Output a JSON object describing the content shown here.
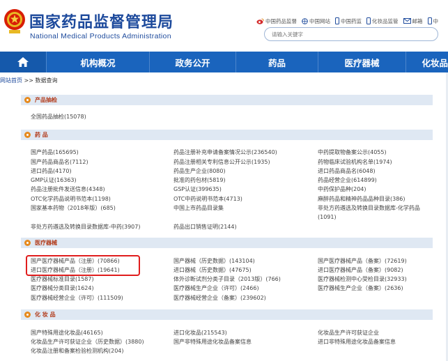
{
  "header": {
    "title_cn": "国家药品监督管理局",
    "title_en": "National Medical Products Administration",
    "toplinks": [
      {
        "label": "中国药品监督",
        "icon": "weibo-icon"
      },
      {
        "label": "中国网站",
        "icon": "globe-icon"
      },
      {
        "label": "中国药监",
        "icon": "mobile-icon"
      },
      {
        "label": "化妆品监管",
        "icon": "mobile-icon"
      },
      {
        "label": "邮箱",
        "icon": "mail-icon"
      },
      {
        "label": "中",
        "icon": "mobile-icon"
      }
    ],
    "search_placeholder": "请输入关键字"
  },
  "nav": {
    "items": [
      "机构概况",
      "政务公开",
      "药品",
      "医疗器械",
      "化妆品"
    ]
  },
  "breadcrumb": {
    "home": "网站首页",
    "sep": " >> ",
    "current": "数据查询"
  },
  "sections": [
    {
      "title": "产品抽检",
      "links": [
        "全国药品抽检(15078)"
      ]
    },
    {
      "title": "药 品",
      "col1": [
        "国产药品(165695)",
        "国产药品商品名(7112)",
        "进口药品(4170)",
        "GMP认证(16363)",
        "药品注册批件发送信息(4348)",
        "OTC化学药品说明书范本(1198)",
        "国家基本药物（2018年版）(685)",
        "",
        "非处方药遴选及转换目录数据库-中药(3907)"
      ],
      "col2": [
        "药品注册补充申请备案情况公示(236540)",
        "药品注册相关专利信息公开公示(1935)",
        "药品生产企业(8080)",
        "批准的药包材(5819)",
        "GSP认证(399635)",
        "OTC中药说明书范本(4713)",
        "中国上市药品目录集",
        "",
        "药品出口销售证明(2144)"
      ],
      "col3": [
        "中药提取物备案公示(4055)",
        "药物临床试验机构名单(1974)",
        "进口药品商品名(6048)",
        "药品经营企业(614899)",
        "中药保护品种(204)",
        "麻醉药品和精神药品品种目录(386)",
        "非处方药遴选及转换目录数据库-化学药品",
        "(1091)"
      ]
    },
    {
      "title": "医疗器械",
      "col1": [
        "国产医疗器械产品（注册）(70866)",
        "进口医疗器械产品（注册）(19641)",
        "医疗器械标准目录(1587)",
        "医疗器械分类目录(1624)",
        "医疗器械经营企业（许可）(111509)"
      ],
      "col2": [
        "国产器械（历史数据）(143104)",
        "进口器械（历史数据）(47675)",
        "体外诊断试剂分类子目录（2013版）(766)",
        "医疗器械生产企业（许可）(2466)",
        "医疗器械经营企业（备案）(239602)"
      ],
      "col3": [
        "国产医疗器械产品（备案）(72619)",
        "进口医疗器械产品（备案）(9082)",
        "医疗器械检测中心受检目录(32933)",
        "医疗器械生产企业（备案）(2636)"
      ]
    },
    {
      "title": "化 妆 品",
      "col1": [
        "国产特殊用途化妆品(46165)",
        "化妆品生产许可获证企业（历史数据）(3880)",
        "化妆品注册和备案检验检测机构(204)"
      ],
      "col2": [
        "进口化妆品(215543)",
        "国产非特殊用途化妆品备案信息"
      ],
      "col3": [
        "化妆品生产许可获证企业",
        "进口非特殊用途化妆品备案信息"
      ]
    }
  ],
  "colors": {
    "brand_blue": "#1d4a9c",
    "nav_blue": "#1a64bd",
    "section_bg": "#dfe8f3",
    "section_title": "#b23a1a",
    "highlight_red": "#e01d1d"
  }
}
